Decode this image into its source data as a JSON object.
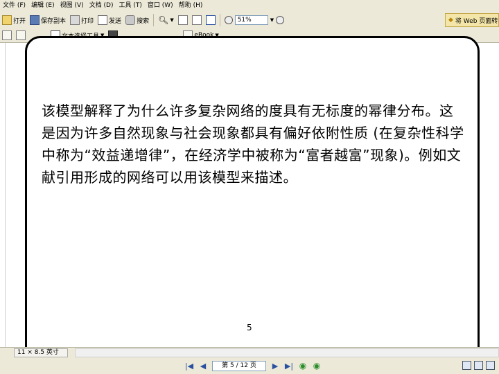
{
  "menu": {
    "items": [
      "文件 (F)",
      "编辑 (E)",
      "视图 (V)",
      "文档 (D)",
      "工具 (T)",
      "窗口 (W)",
      "帮助 (H)"
    ]
  },
  "toolbar1": {
    "open_label": "打开",
    "save_copy_label": "保存副本",
    "print_label": "打印",
    "email_label": "发送",
    "search_label": "搜索",
    "zoom_value": "51%",
    "web_label": "将 Web 页面转换为"
  },
  "toolbar2": {
    "text_select_label": "文本选择工具",
    "ebook_label": "eBook"
  },
  "document": {
    "body_text": "该模型解释了为什么许多复杂网络的度具有无标度的幂律分布。这是因为许多自然现象与社会现象都具有偏好依附性质 (在复杂性科学中称为“效益递增律”，在经济学中被称为“富者越富”现象)。例如文献引用形成的网络可以用该模型来描述。",
    "slide_page_number": "5"
  },
  "status": {
    "page_size": "11 × 8.5 英寸"
  },
  "nav": {
    "page_indicator": "第 5 / 12 页"
  }
}
